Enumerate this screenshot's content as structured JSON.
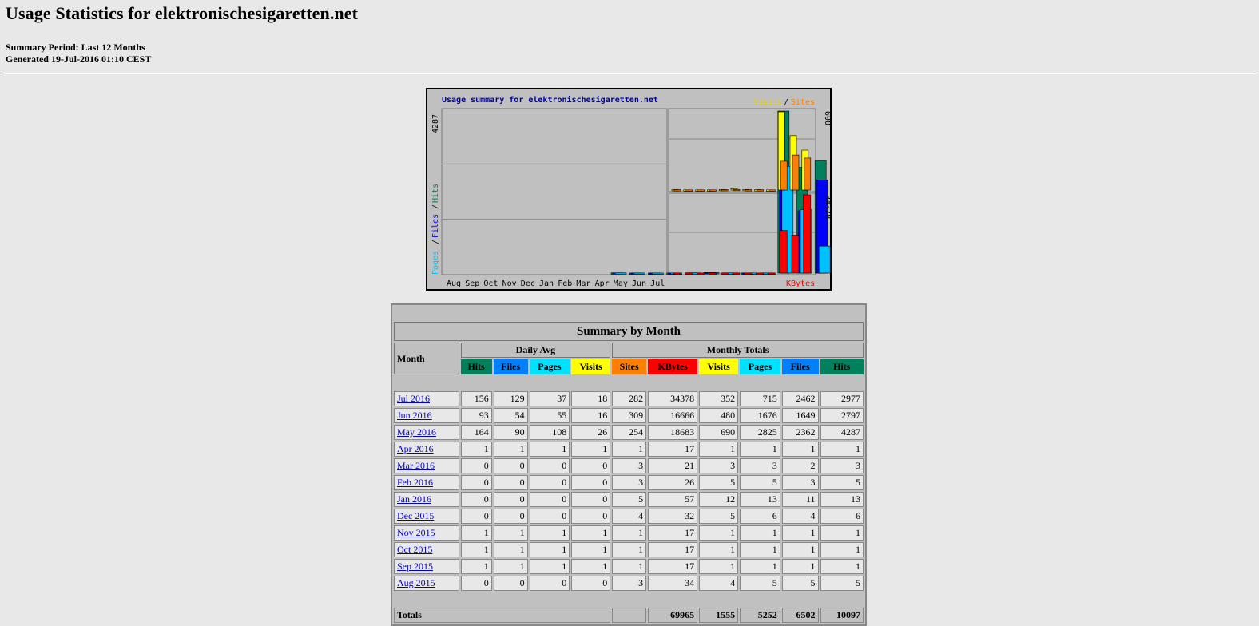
{
  "page": {
    "title": "Usage Statistics for elektronischesigaretten.net",
    "summary_period": "Summary Period: Last 12 Months",
    "generated": "Generated 19-Jul-2016 01:10 CEST"
  },
  "graph": {
    "title": "Usage summary for elektronischesigaretten.net",
    "legend_visits": "Visits",
    "legend_slash": "/",
    "legend_sites": "Sites",
    "left_axis_label_pages": "Pages",
    "left_axis_label_files": "Files",
    "left_axis_label_hits": "Hits",
    "left_max": "4287",
    "right_top_max": "690",
    "right_bottom_max": "34378",
    "kbytes_label": "KBytes",
    "months": [
      "Aug",
      "Sep",
      "Oct",
      "Nov",
      "Dec",
      "Jan",
      "Feb",
      "Mar",
      "Apr",
      "May",
      "Jun",
      "Jul"
    ],
    "colors": {
      "hits": "#00805c",
      "files": "#0000ff",
      "pages": "#00c0ff",
      "visits": "#ffff00",
      "sites": "#ff8000",
      "kbytes": "#ff0000"
    }
  },
  "chart_data": {
    "type": "bar",
    "title": "Usage summary for elektronischesigaretten.net",
    "categories": [
      "Aug",
      "Sep",
      "Oct",
      "Nov",
      "Dec",
      "Jan",
      "Feb",
      "Mar",
      "Apr",
      "May",
      "Jun",
      "Jul"
    ],
    "series": [
      {
        "name": "Hits",
        "values": [
          5,
          1,
          1,
          1,
          6,
          13,
          5,
          3,
          1,
          4287,
          2797,
          2977
        ]
      },
      {
        "name": "Files",
        "values": [
          5,
          1,
          1,
          1,
          4,
          11,
          3,
          2,
          1,
          2362,
          1649,
          2462
        ]
      },
      {
        "name": "Pages",
        "values": [
          5,
          1,
          1,
          1,
          6,
          13,
          5,
          3,
          1,
          2825,
          1676,
          715
        ]
      },
      {
        "name": "Visits",
        "values": [
          4,
          1,
          1,
          1,
          5,
          12,
          5,
          3,
          1,
          690,
          480,
          352
        ]
      },
      {
        "name": "Sites",
        "values": [
          3,
          1,
          1,
          1,
          4,
          5,
          3,
          3,
          1,
          254,
          309,
          282
        ]
      },
      {
        "name": "KBytes",
        "values": [
          34,
          17,
          17,
          17,
          32,
          57,
          26,
          21,
          17,
          18683,
          16666,
          34378
        ]
      }
    ]
  },
  "table": {
    "title": "Summary by Month",
    "daily_avg": "Daily Avg",
    "monthly_totals": "Monthly Totals",
    "month_header": "Month",
    "columns": [
      "Hits",
      "Files",
      "Pages",
      "Visits",
      "Sites",
      "KBytes",
      "Visits",
      "Pages",
      "Files",
      "Hits"
    ],
    "rows": [
      {
        "month": "Jul 2016",
        "v": [
          "156",
          "129",
          "37",
          "18",
          "282",
          "34378",
          "352",
          "715",
          "2462",
          "2977"
        ]
      },
      {
        "month": "Jun 2016",
        "v": [
          "93",
          "54",
          "55",
          "16",
          "309",
          "16666",
          "480",
          "1676",
          "1649",
          "2797"
        ]
      },
      {
        "month": "May 2016",
        "v": [
          "164",
          "90",
          "108",
          "26",
          "254",
          "18683",
          "690",
          "2825",
          "2362",
          "4287"
        ]
      },
      {
        "month": "Apr 2016",
        "v": [
          "1",
          "1",
          "1",
          "1",
          "1",
          "17",
          "1",
          "1",
          "1",
          "1"
        ]
      },
      {
        "month": "Mar 2016",
        "v": [
          "0",
          "0",
          "0",
          "0",
          "3",
          "21",
          "3",
          "3",
          "2",
          "3"
        ]
      },
      {
        "month": "Feb 2016",
        "v": [
          "0",
          "0",
          "0",
          "0",
          "3",
          "26",
          "5",
          "5",
          "3",
          "5"
        ]
      },
      {
        "month": "Jan 2016",
        "v": [
          "0",
          "0",
          "0",
          "0",
          "5",
          "57",
          "12",
          "13",
          "11",
          "13"
        ]
      },
      {
        "month": "Dec 2015",
        "v": [
          "0",
          "0",
          "0",
          "0",
          "4",
          "32",
          "5",
          "6",
          "4",
          "6"
        ]
      },
      {
        "month": "Nov 2015",
        "v": [
          "1",
          "1",
          "1",
          "1",
          "1",
          "17",
          "1",
          "1",
          "1",
          "1"
        ]
      },
      {
        "month": "Oct 2015",
        "v": [
          "1",
          "1",
          "1",
          "1",
          "1",
          "17",
          "1",
          "1",
          "1",
          "1"
        ]
      },
      {
        "month": "Sep 2015",
        "v": [
          "1",
          "1",
          "1",
          "1",
          "1",
          "17",
          "1",
          "1",
          "1",
          "1"
        ]
      },
      {
        "month": "Aug 2015",
        "v": [
          "0",
          "0",
          "0",
          "0",
          "3",
          "34",
          "4",
          "5",
          "5",
          "5"
        ]
      }
    ],
    "totals_label": "Totals",
    "totals": [
      "69965",
      "1555",
      "5252",
      "6502",
      "10097"
    ]
  }
}
